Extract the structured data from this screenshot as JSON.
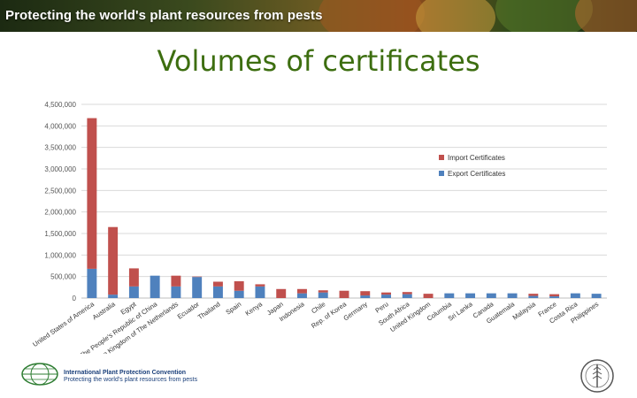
{
  "header": {
    "banner_text": "Protecting the world's plant resources from pests"
  },
  "page": {
    "title": "Volumes of certificates"
  },
  "footer": {
    "org_name": "International Plant Protection Convention",
    "tagline": "Protecting the world's plant resources from pests"
  },
  "colors": {
    "import": "#c0504d",
    "export": "#4f81bd",
    "title": "#3d6e10",
    "grid": "#d9d9d9"
  },
  "icons": {
    "ippc_logo": "globe-icon",
    "fao_logo": "fao-emblem-icon"
  },
  "chart_data": {
    "type": "bar",
    "stacked": true,
    "categories": [
      "United States of America",
      "Australia",
      "Egypt",
      "The People's Republic of China",
      "The Kingdom of The Netherlands",
      "Ecuador",
      "Thailand",
      "Spain",
      "Kenya",
      "Japan",
      "Indonesia",
      "Chile",
      "Rep. of Korea",
      "Germany",
      "Peru",
      "South Africa",
      "United Kingdom",
      "Columbia",
      "Sri Lanka",
      "Canada",
      "Guatemala",
      "Malaysia",
      "France",
      "Costa Rica",
      "Philippines"
    ],
    "series": [
      {
        "name": "Export Certificates",
        "values": [
          680000,
          80000,
          270000,
          520000,
          270000,
          490000,
          270000,
          170000,
          270000,
          0,
          110000,
          130000,
          0,
          60000,
          80000,
          90000,
          0,
          110000,
          110000,
          110000,
          110000,
          50000,
          40000,
          110000,
          100000
        ]
      },
      {
        "name": "Import Certificates",
        "values": [
          3500000,
          1570000,
          420000,
          0,
          250000,
          10000,
          110000,
          220000,
          50000,
          210000,
          100000,
          50000,
          170000,
          100000,
          50000,
          50000,
          100000,
          0,
          0,
          0,
          0,
          50000,
          50000,
          0,
          0
        ]
      }
    ],
    "ylim": [
      0,
      4500000
    ],
    "yticks": [
      0,
      500000,
      1000000,
      1500000,
      2000000,
      2500000,
      3000000,
      3500000,
      4000000,
      4500000
    ],
    "ytick_labels": [
      "0",
      "500,000",
      "1,000,000",
      "1,500,000",
      "2,000,000",
      "2,500,000",
      "3,000,000",
      "3,500,000",
      "4,000,000",
      "4,500,000"
    ],
    "legend_order": [
      "Import Certificates",
      "Export Certificates"
    ],
    "legend_position": "top-right",
    "grid": true
  }
}
